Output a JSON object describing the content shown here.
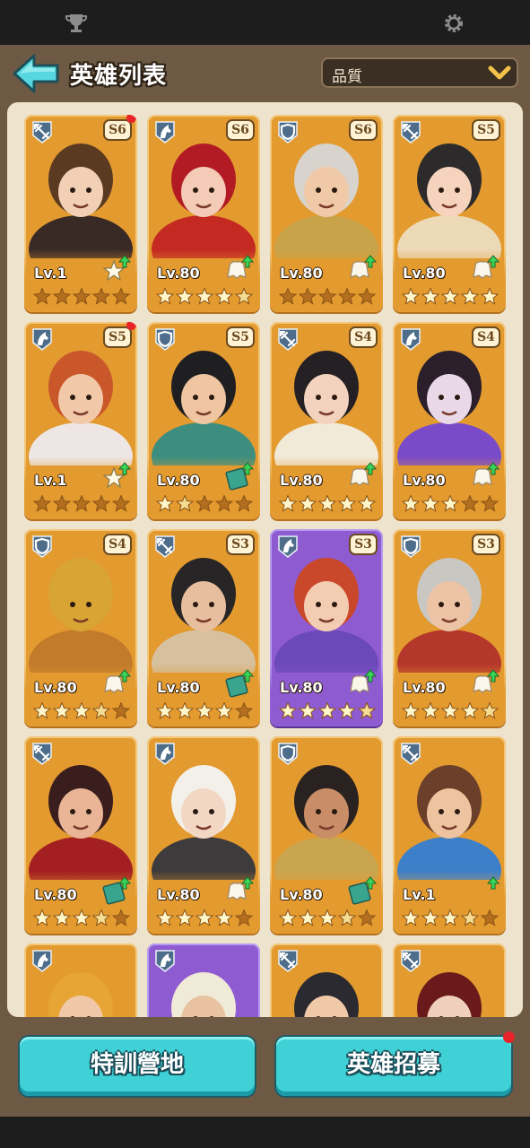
{
  "header": {
    "title": "英雄列表",
    "sort_label": "品質",
    "back_icon": "back-arrow-icon",
    "sort_icon": "chevron-down-icon"
  },
  "status_bar": {
    "left_icon": "trophy-icon",
    "right_icon": "gear-icon"
  },
  "colors": {
    "card_orange": "#e39a2f",
    "card_purple": "#8f5bd1",
    "button_cyan": "#3fd1d6",
    "badge_red": "#e8242b"
  },
  "heroes": [
    {
      "class": "crossbow",
      "rank": "S6",
      "level": "Lv.1",
      "stars": 0,
      "item": "scroll",
      "upgrade": true,
      "new": true
    },
    {
      "class": "cavalry",
      "rank": "S6",
      "level": "Lv.80",
      "stars": 4.5,
      "item": "cloak",
      "upgrade": true,
      "new": false
    },
    {
      "class": "shield",
      "rank": "S6",
      "level": "Lv.80",
      "stars": 0,
      "item": "cloak",
      "upgrade": true,
      "new": false
    },
    {
      "class": "crossbow",
      "rank": "S5",
      "level": "Lv.80",
      "stars": 5,
      "item": "cloak",
      "upgrade": true,
      "new": false
    },
    {
      "class": "cavalry",
      "rank": "S5",
      "level": "Lv.1",
      "stars": 0,
      "item": "scroll",
      "upgrade": true,
      "new": true
    },
    {
      "class": "shield",
      "rank": "S5",
      "level": "Lv.80",
      "stars": 1.5,
      "item": "book",
      "upgrade": true,
      "new": false
    },
    {
      "class": "crossbow",
      "rank": "S4",
      "level": "Lv.80",
      "stars": 5,
      "item": "cloak",
      "upgrade": true,
      "new": false
    },
    {
      "class": "cavalry",
      "rank": "S4",
      "level": "Lv.80",
      "stars": 3,
      "item": "cloak",
      "upgrade": true,
      "new": false
    },
    {
      "class": "shield",
      "rank": "S4",
      "level": "Lv.80",
      "stars": 3.5,
      "item": "cloak",
      "upgrade": true,
      "new": false
    },
    {
      "class": "crossbow",
      "rank": "S3",
      "level": "Lv.80",
      "stars": 4,
      "item": "book",
      "upgrade": true,
      "new": false
    },
    {
      "class": "cavalry",
      "rank": "S3",
      "level": "Lv.80",
      "stars": 4.5,
      "item": "cloak",
      "upgrade": true,
      "new": false
    },
    {
      "class": "shield",
      "rank": "S3",
      "level": "Lv.80",
      "stars": 4.5,
      "item": "cloak",
      "upgrade": true,
      "new": false
    },
    {
      "class": "crossbow",
      "rank": "",
      "level": "Lv.80",
      "stars": 3.5,
      "item": "book",
      "upgrade": true,
      "new": false
    },
    {
      "class": "cavalry",
      "rank": "",
      "level": "Lv.80",
      "stars": 4,
      "item": "cloak",
      "upgrade": true,
      "new": false
    },
    {
      "class": "shield",
      "rank": "",
      "level": "Lv.80",
      "stars": 3.5,
      "item": "book",
      "upgrade": true,
      "new": false
    },
    {
      "class": "crossbow",
      "rank": "",
      "level": "Lv.1",
      "stars": 3.5,
      "item": "none",
      "upgrade": true,
      "new": false
    },
    {
      "class": "cavalry",
      "rank": "",
      "level": "",
      "stars": 0,
      "item": "none",
      "upgrade": false,
      "new": false
    },
    {
      "class": "cavalry",
      "rank": "",
      "level": "",
      "stars": 0,
      "item": "none",
      "upgrade": false,
      "new": false
    },
    {
      "class": "crossbow",
      "rank": "",
      "level": "",
      "stars": 0,
      "item": "none",
      "upgrade": false,
      "new": false
    },
    {
      "class": "crossbow",
      "rank": "",
      "level": "",
      "stars": 0,
      "item": "none",
      "upgrade": false,
      "new": false
    }
  ],
  "buttons": {
    "training_camp": "特訓營地",
    "recruit": "英雄招募"
  }
}
